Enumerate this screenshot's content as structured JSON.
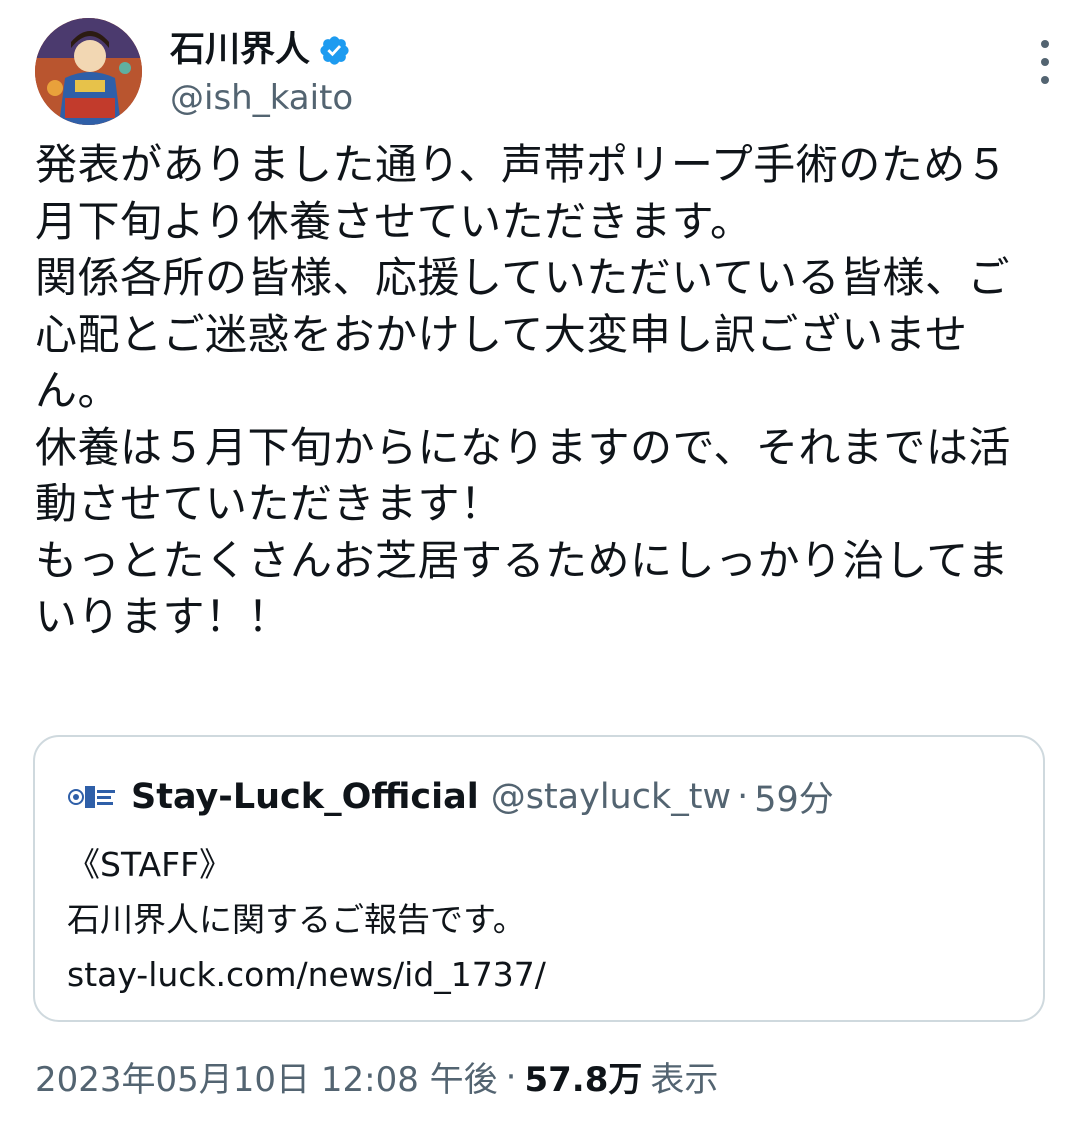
{
  "header": {
    "display_name": "石川界人",
    "handle": "@ish_kaito"
  },
  "tweet": {
    "text": "発表がありました通り、声帯ポリープ手術のため５月下旬より休養させていただきます。\n関係各所の皆様、応援していただいている皆様、ご心配とご迷惑をおかけして大変申し訳ございません。\n休養は５月下旬からになりますので、それまでは活動させていただきます！\nもっとたくさんお芝居するためにしっかり治してまいります！！"
  },
  "quote": {
    "name": "Stay-Luck_Official",
    "handle": "@stayluck_tw",
    "separator": "·",
    "time": "59分",
    "body_line1": "《STAFF》",
    "body_line2": "石川界人に関するご報告です。",
    "body_line3": "stay-luck.com/news/id_1737/"
  },
  "meta": {
    "datetime": "2023年05月10日 12:08 午後",
    "separator": "·",
    "views_count": "57.8万",
    "views_label": "表示"
  },
  "colors": {
    "verified_blue": "#1d9bf0",
    "secondary_text": "#536471",
    "border": "#cfd9de"
  }
}
